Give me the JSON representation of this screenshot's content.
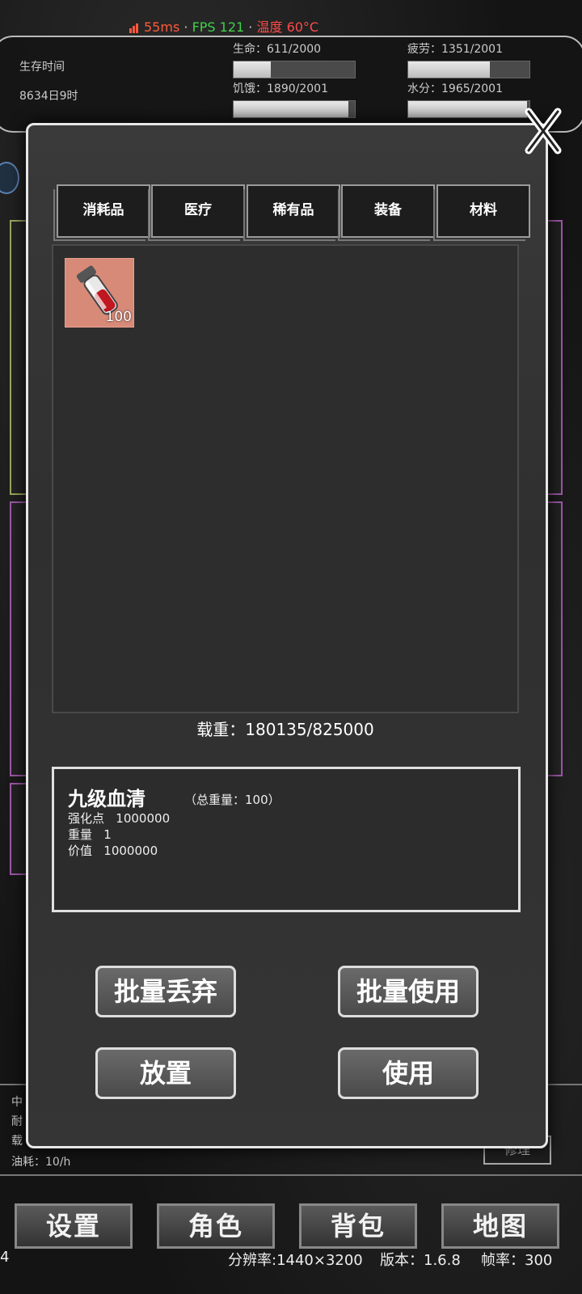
{
  "perf": {
    "ping": "55ms",
    "fps": "FPS 121",
    "temp": "温度 60°C",
    "sep1": "·",
    "sep2": "·",
    "colors": {
      "ping": "#ff5a3c",
      "fps": "#41d14a",
      "temp": "#ff4a4a"
    }
  },
  "status": {
    "survive_label": "生存时间",
    "survive_value": "8634日9时",
    "life": {
      "label": "生命：611/2000",
      "current": 611,
      "max": 2000
    },
    "fatigue": {
      "label": "疲劳：1351/2001",
      "current": 1351,
      "max": 2001
    },
    "hunger": {
      "label": "饥饿：1890/2001",
      "current": 1890,
      "max": 2001
    },
    "water": {
      "label": "水分：1965/2001",
      "current": 1965,
      "max": 2001
    }
  },
  "inventory": {
    "tabs": [
      "消耗品",
      "医疗",
      "稀有品",
      "装备",
      "材料"
    ],
    "items": [
      {
        "icon": "blood-serum-vial-icon",
        "qty": "100"
      }
    ],
    "weight": "载重：180135/825000"
  },
  "detail": {
    "name": "九级血清",
    "total_weight": "（总重量：100）",
    "lines": [
      "强化点   1000000",
      "重量   1",
      "价值   1000000"
    ]
  },
  "buttons": {
    "batch_discard": "批量丢弃",
    "batch_use": "批量使用",
    "place": "放置",
    "use": "使用"
  },
  "background_info": {
    "fuel": "油耗：10/h",
    "partial1": "中",
    "partial2": "耐",
    "partial3": "载",
    "repair": "修理"
  },
  "nav": [
    "设置",
    "角色",
    "背包",
    "地图"
  ],
  "footer": {
    "left": "4",
    "resolution": "分辨率:1440×3200",
    "version": "版本：1.6.8",
    "framerate": "帧率：300"
  }
}
